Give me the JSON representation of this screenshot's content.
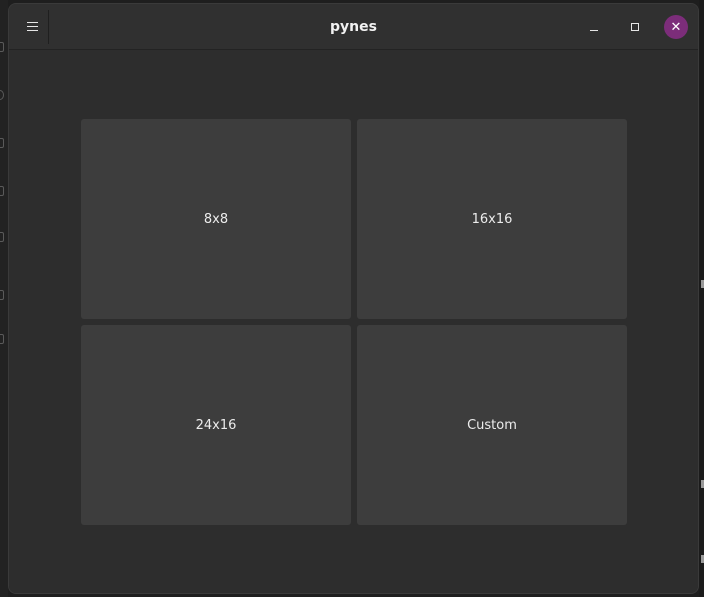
{
  "window": {
    "title": "pynes",
    "close_symbol": "✕"
  },
  "icons": {
    "menu": "hamburger-menu-icon",
    "minimize": "minimize-icon",
    "maximize": "maximize-icon",
    "close": "close-icon"
  },
  "tiles": [
    {
      "label": "8x8"
    },
    {
      "label": "16x16"
    },
    {
      "label": "24x16"
    },
    {
      "label": "Custom"
    }
  ],
  "colors": {
    "accent_close": "#7c2d7a",
    "window_bg": "#2d2d2d",
    "tile_bg": "#3d3d3d"
  }
}
